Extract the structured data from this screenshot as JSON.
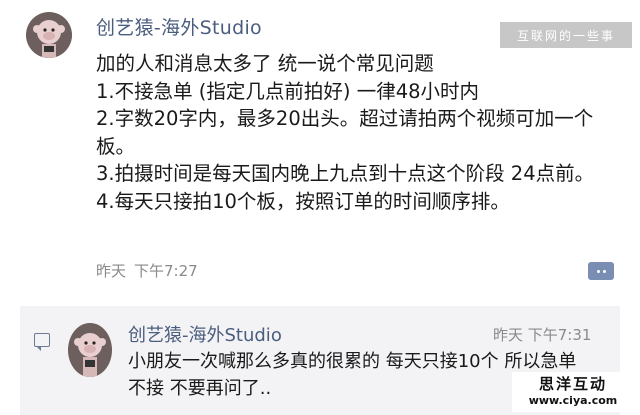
{
  "post": {
    "author": "创艺猿-海外Studio",
    "lines": [
      "加的人和消息太多了 统一说个常见问题",
      "1.不接急单 (指定几点前拍好) 一律48小时内",
      "2.字数20字内，最多20出头。超过请拍两个视频可加一个板。",
      "3.拍摄时间是每天国内晚上九点到十点这个阶段 24点前。",
      "4.每天只接拍10个板，按照订单的时间顺序排。"
    ],
    "day": "昨天",
    "time": "下午7:27"
  },
  "comment": {
    "author": "创艺猿-海外Studio",
    "timestamp": "昨天 下午7:31",
    "text": "小朋友一次喊那么多真的很累的 每天只接10个 所以急单不接 不要再问了.."
  },
  "watermarks": {
    "top": "互联网的一些事",
    "bottom_name": "思洋互动",
    "bottom_url": "www.ciya.com"
  },
  "colors": {
    "author_link": "#4b5d7e",
    "meta_gray": "#8a8a8a",
    "comment_bg": "#f3f3f5",
    "comment_button": "#7a8db3"
  }
}
